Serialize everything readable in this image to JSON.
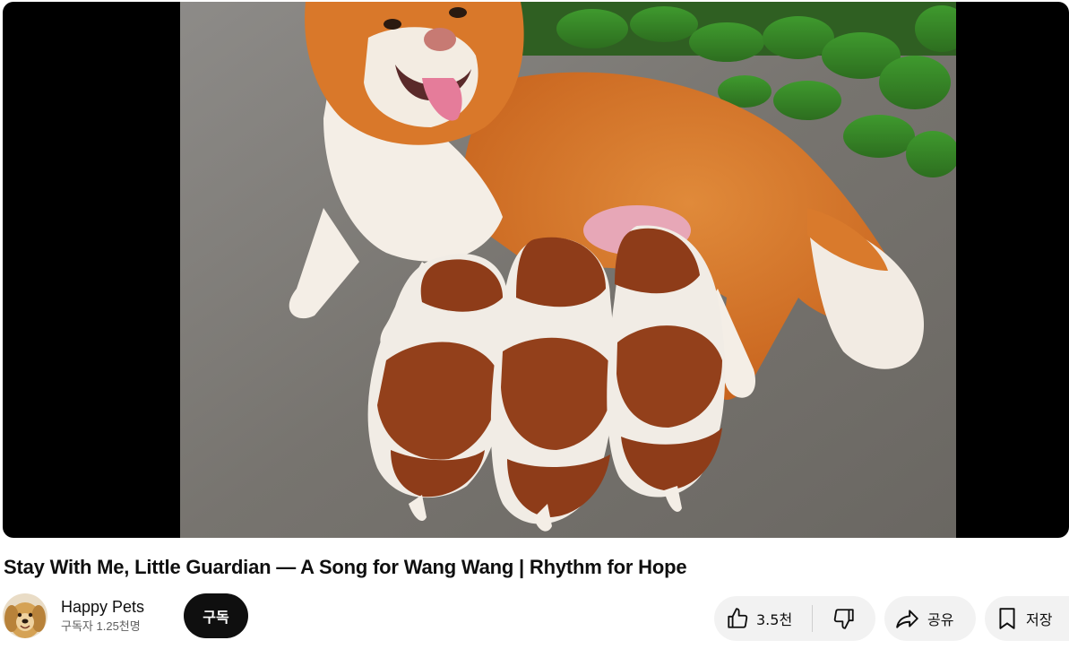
{
  "video": {
    "title": "Stay With Me, Little Guardian — A Song for Wang Wang | Rhythm for Hope",
    "thumbnail_description_icon": "mother-dog-nursing-puppies-frame"
  },
  "channel": {
    "name": "Happy Pets",
    "subscribers": "구독자 1.25천명",
    "avatar_icon": "golden-retriever-avatar"
  },
  "subscribe": {
    "label": "구독"
  },
  "actions": {
    "like_count": "3.5천",
    "share_label": "공유",
    "save_label": "저장"
  },
  "colors": {
    "player_bg": "#000000",
    "button_bg": "#f2f2f2",
    "subscribe_bg": "#0f0f0f",
    "text": "#0f0f0f",
    "secondary_text": "#606060"
  }
}
